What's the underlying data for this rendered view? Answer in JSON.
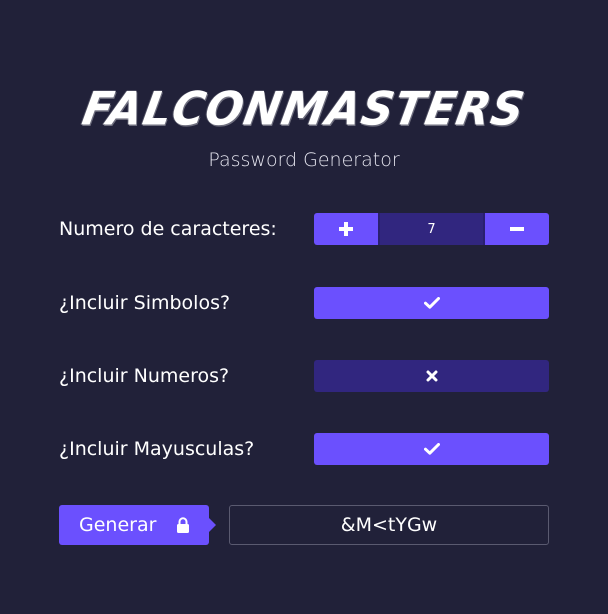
{
  "brand": {
    "logo_text": "FALCONMASTERS",
    "subtitle": "Password Generator"
  },
  "form": {
    "length": {
      "label": "Numero de caracteres:",
      "value": "7",
      "increment_icon": "plus-icon",
      "decrement_icon": "minus-icon"
    },
    "symbols": {
      "label": "¿Incluir Simbolos?",
      "enabled": true,
      "icon": "check-icon"
    },
    "numbers": {
      "label": "¿Incluir Numeros?",
      "enabled": false,
      "icon": "x-icon"
    },
    "uppercase": {
      "label": "¿Incluir Mayusculas?",
      "enabled": true,
      "icon": "check-icon"
    }
  },
  "generate": {
    "label": "Generar",
    "icon": "lock-icon"
  },
  "output": {
    "value": "&M<tYGw"
  },
  "colors": {
    "background": "#212139",
    "accent": "#6b50fe",
    "accent_dark": "#31267f",
    "text": "#ffffff",
    "output_border": "#5a5a70"
  }
}
